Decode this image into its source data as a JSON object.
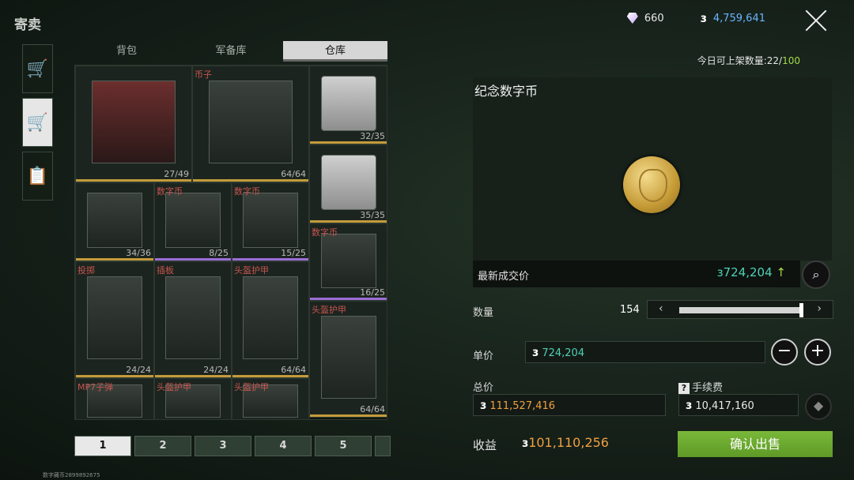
{
  "window_title": "寄卖",
  "currency": {
    "diamond": "660",
    "coin": "4,759,641"
  },
  "tabs": [
    "背包",
    "军备库",
    "仓库"
  ],
  "grid_items": [
    {
      "label": "",
      "count": "27/49",
      "bar": "#c49b3a",
      "style": "red"
    },
    {
      "label": "币子",
      "count": "64/64",
      "bar": "#c49b3a",
      "style": "dark"
    },
    {
      "label": "",
      "count": "32/35",
      "bar": "#c49b3a",
      "style": "grey"
    },
    {
      "label": "",
      "count": "35/35",
      "bar": "#c49b3a",
      "style": "grey"
    },
    {
      "label": "",
      "count": "34/36",
      "bar": "#c49b3a",
      "style": "dark"
    },
    {
      "label": "数字币",
      "count": "8/25",
      "bar": "#9b6ed6",
      "style": "dark"
    },
    {
      "label": "数字币",
      "count": "15/25",
      "bar": "#9b6ed6",
      "style": "dark"
    },
    {
      "label": "数字币",
      "count": "16/25",
      "bar": "#9b6ed6",
      "style": "dark"
    },
    {
      "label": "投掷",
      "count": "24/24",
      "bar": "#c49b3a",
      "style": "dark"
    },
    {
      "label": "插板",
      "count": "24/24",
      "bar": "#c49b3a",
      "style": "dark"
    },
    {
      "label": "头盔护甲",
      "count": "64/64",
      "bar": "#c49b3a",
      "style": "dark"
    },
    {
      "label": "头盔护甲",
      "count": "64/64",
      "bar": "#c49b3a",
      "style": "dark"
    },
    {
      "label": "MP7子弹",
      "count": "",
      "bar": "#c49b3a",
      "style": "dark"
    },
    {
      "label": "头盔护甲",
      "count": "",
      "bar": "#c49b3a",
      "style": "dark"
    },
    {
      "label": "头盔护甲",
      "count": "",
      "bar": "#c49b3a",
      "style": "dark"
    }
  ],
  "pages": [
    "1",
    "2",
    "3",
    "4",
    "5"
  ],
  "watermark": "数字藏币2899892675",
  "daily_limit": {
    "label": "今日可上架数量:",
    "current": "22",
    "max": "100"
  },
  "item_name": "纪念数字币",
  "last_price": {
    "label": "最新成交价",
    "value": "724,204",
    "trend": "up"
  },
  "quantity": {
    "label": "数量",
    "value": "154"
  },
  "unit_price": {
    "label": "单价",
    "value": "724,204"
  },
  "total": {
    "label": "总价",
    "value": "111,527,416"
  },
  "fee": {
    "label": "手续费",
    "value": "10,417,160"
  },
  "income": {
    "label": "收益",
    "value": "101,110,256"
  },
  "confirm_label": "确认出售",
  "colors": {
    "accent": "#6fac34",
    "price_green": "#4fd1b5",
    "price_orange": "#f0a040",
    "coin_blue": "#6ab4ff"
  }
}
